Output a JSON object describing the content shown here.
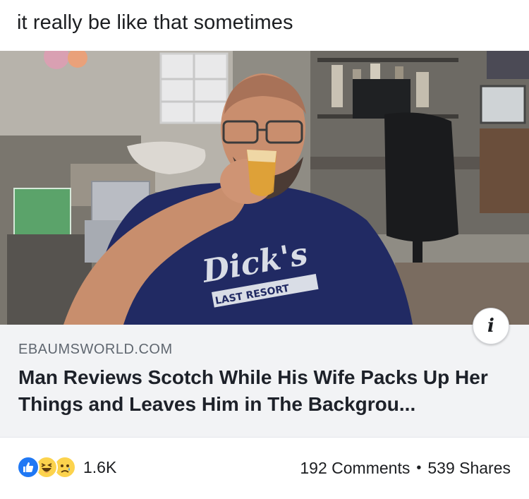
{
  "post": {
    "caption": "it really be like that sometimes"
  },
  "link_preview": {
    "domain": "EBAUMSWORLD.COM",
    "headline": "Man Reviews Scotch While His Wife Packs Up Her Things and Leaves Him in The Backgrou...",
    "image_shirt_text": "Dick's",
    "image_shirt_subtext": "LAST RESORT",
    "info_icon": "info-icon"
  },
  "engagement": {
    "reaction_icons": [
      "like-icon",
      "haha-icon",
      "sad-icon"
    ],
    "reaction_count": "1.6K",
    "comments": "192 Comments",
    "separator": "•",
    "shares": "539 Shares"
  },
  "colors": {
    "like_blue": "#2078f4",
    "emoji_yellow": "#fcd34d",
    "meta_background": "#f2f3f5",
    "domain_gray": "#606770"
  }
}
